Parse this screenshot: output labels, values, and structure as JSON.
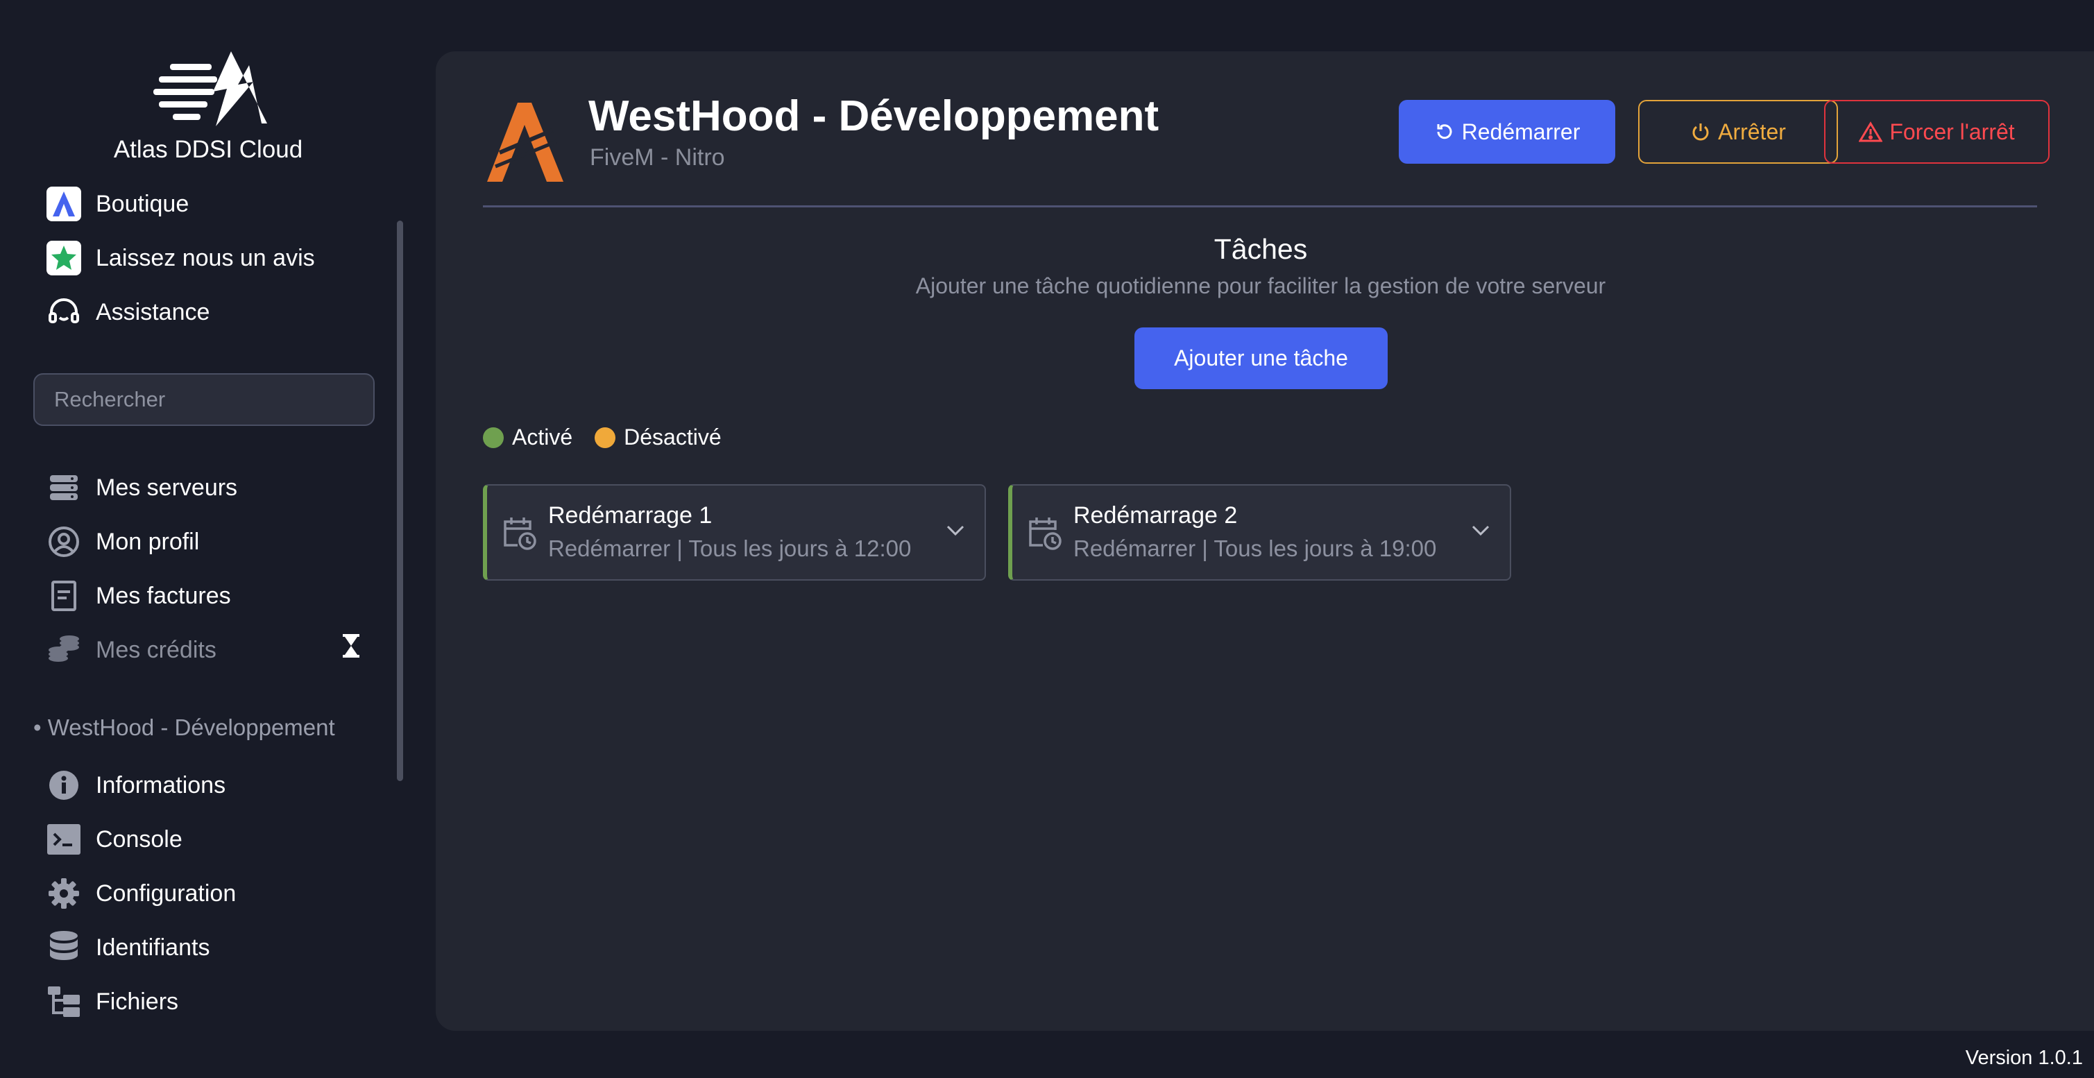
{
  "brand": {
    "name": "Atlas DDSI Cloud",
    "logo_icon": "atlas-lightning-logo"
  },
  "top_links": [
    {
      "label": "Boutique",
      "icon": "atlas-shop-icon"
    },
    {
      "label": "Laissez nous un avis",
      "icon": "star-icon"
    },
    {
      "label": "Assistance",
      "icon": "headset-icon"
    }
  ],
  "search": {
    "placeholder": "Rechercher",
    "value": ""
  },
  "account_nav": [
    {
      "label": "Mes serveurs",
      "icon": "server-icon"
    },
    {
      "label": "Mon profil",
      "icon": "user-circle-icon"
    },
    {
      "label": "Mes factures",
      "icon": "invoice-icon"
    },
    {
      "label": "Mes crédits",
      "icon": "coins-icon",
      "disabled": true
    }
  ],
  "server_section": {
    "label": "• WestHood - Développement",
    "items": [
      {
        "label": "Informations",
        "icon": "info-icon"
      },
      {
        "label": "Console",
        "icon": "terminal-icon"
      },
      {
        "label": "Configuration",
        "icon": "gear-icon"
      },
      {
        "label": "Identifiants",
        "icon": "database-icon"
      },
      {
        "label": "Fichiers",
        "icon": "file-tree-icon"
      }
    ]
  },
  "server": {
    "title": "WestHood - Développement",
    "subtitle": "FiveM - Nitro"
  },
  "actions": {
    "restart": "Redémarrer",
    "stop": "Arrêter",
    "force_stop": "Forcer l'arrêt"
  },
  "tasks": {
    "title": "Tâches",
    "subtitle": "Ajouter une tâche quotidienne pour faciliter la gestion de votre serveur",
    "add_button": "Ajouter une tâche",
    "legend": [
      {
        "label": "Activé",
        "color": "#6fa04f"
      },
      {
        "label": "Désactivé",
        "color": "#f0a93a"
      }
    ],
    "items": [
      {
        "name": "Redémarrage 1",
        "description": "Redémarrer | Tous les jours à 12:00",
        "status": "Activé"
      },
      {
        "name": "Redémarrage 2",
        "description": "Redémarrer | Tous les jours à 19:00",
        "status": "Activé"
      }
    ]
  },
  "footer": {
    "version": "Version 1.0.1"
  },
  "colors": {
    "accent": "#4563ee",
    "warning": "#f0ac40",
    "danger": "#ff4a50",
    "active": "#6fa04f",
    "panel": "#232631",
    "background": "#181b27"
  }
}
